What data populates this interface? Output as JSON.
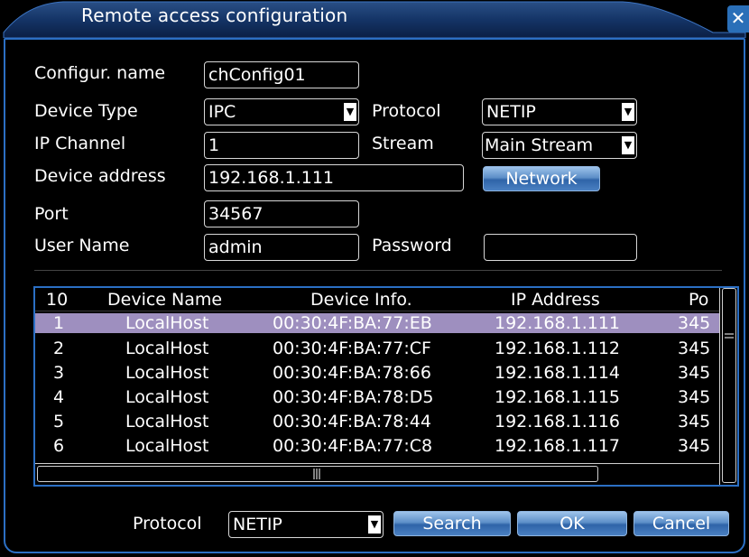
{
  "window": {
    "title": "Remote access configuration",
    "close_symbol": "✕"
  },
  "form": {
    "config_name_label": "Configur. name",
    "config_name_value": "chConfig01",
    "device_type_label": "Device Type",
    "device_type_value": "IPC",
    "protocol_label": "Protocol",
    "protocol_value": "NETIP",
    "ip_channel_label": "IP Channel",
    "ip_channel_value": "1",
    "stream_label": "Stream",
    "stream_value": "Main Stream",
    "device_address_label": "Device address",
    "device_address_value": "192.168.1.111",
    "network_button": "Network",
    "port_label": "Port",
    "port_value": "34567",
    "user_name_label": "User Name",
    "user_name_value": "admin",
    "password_label": "Password",
    "password_value": ""
  },
  "table": {
    "headers": [
      "10",
      "Device Name",
      "Device Info.",
      "IP Address",
      "Po"
    ],
    "rows": [
      [
        "1",
        "LocalHost",
        "00:30:4F:BA:77:EB",
        "192.168.1.111",
        "345"
      ],
      [
        "2",
        "LocalHost",
        "00:30:4F:BA:77:CF",
        "192.168.1.112",
        "345"
      ],
      [
        "3",
        "LocalHost",
        "00:30:4F:BA:78:66",
        "192.168.1.114",
        "345"
      ],
      [
        "4",
        "LocalHost",
        "00:30:4F:BA:78:D5",
        "192.168.1.115",
        "345"
      ],
      [
        "5",
        "LocalHost",
        "00:30:4F:BA:78:44",
        "192.168.1.116",
        "345"
      ],
      [
        "6",
        "LocalHost",
        "00:30:4F:BA:77:C8",
        "192.168.1.117",
        "345"
      ]
    ],
    "selected_row": 0
  },
  "footer": {
    "protocol_label": "Protocol",
    "protocol_value": "NETIP",
    "search_button": "Search",
    "ok_button": "OK",
    "cancel_button": "Cancel"
  },
  "colors": {
    "accent": "#2b6fc4",
    "selected_row": "#9e8fbf"
  }
}
